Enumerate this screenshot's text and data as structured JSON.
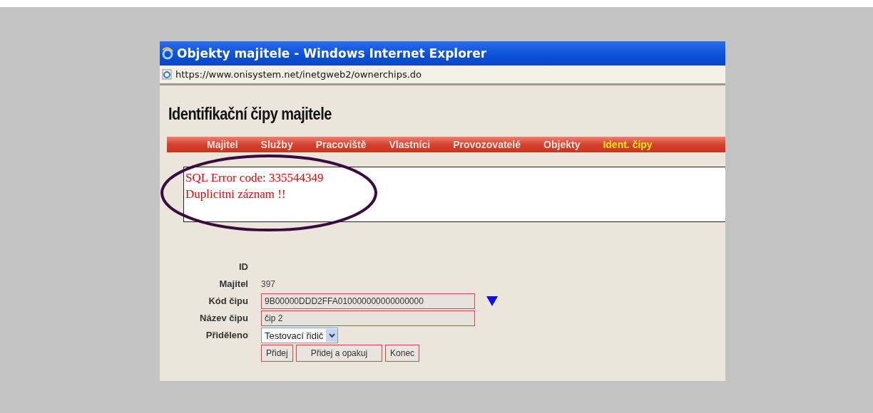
{
  "window": {
    "title": "Objekty majitele - Windows Internet Explorer"
  },
  "address_bar": {
    "url": "https://www.onisystem.net/inetgweb2/ownerchips.do"
  },
  "heading": "Identifikační čipy majitele",
  "nav": [
    {
      "label": "Majitel",
      "selected": false
    },
    {
      "label": "Služby",
      "selected": false
    },
    {
      "label": "Pracoviště",
      "selected": false
    },
    {
      "label": "Vlastníci",
      "selected": false
    },
    {
      "label": "Provozovatelé",
      "selected": false
    },
    {
      "label": "Objekty",
      "selected": false
    },
    {
      "label": "Ident. čipy",
      "selected": true
    }
  ],
  "error_box": {
    "lines": [
      "SQL Error code: 335544349",
      "Duplicitni záznam !!"
    ]
  },
  "form": [
    {
      "label": "ID",
      "kind": "value"
    },
    {
      "label": "Majitel",
      "kind": "value",
      "value": "397"
    },
    {
      "label": "Kód čipu",
      "kind": "input",
      "value": "9B00000DDD2FFA010000000000000000",
      "picker": true
    },
    {
      "label": "Název čipu",
      "kind": "input",
      "value": "čip 2"
    },
    {
      "label": "Přiděleno",
      "kind": "select",
      "value": "Testovací řidič"
    }
  ],
  "buttons": [
    "Přidej",
    "Přidej a opakuj",
    "Konec"
  ]
}
